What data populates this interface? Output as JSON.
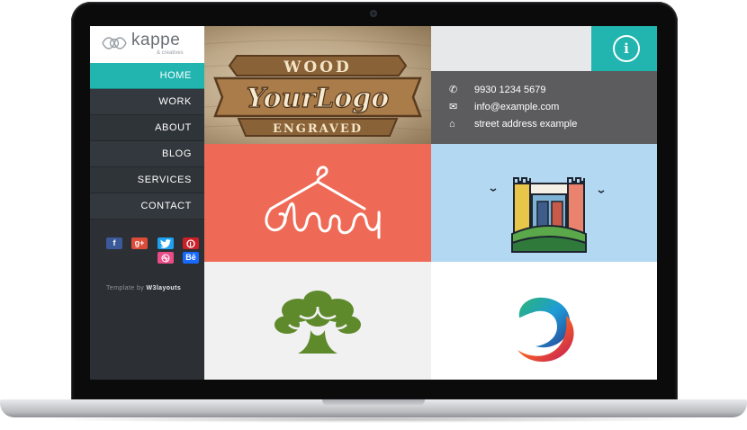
{
  "brand": {
    "name": "kappe",
    "tagline": "& creatives"
  },
  "nav": {
    "items": [
      {
        "label": "HOME"
      },
      {
        "label": "WORK"
      },
      {
        "label": "ABOUT"
      },
      {
        "label": "BLOG"
      },
      {
        "label": "SERVICES"
      },
      {
        "label": "CONTACT"
      }
    ],
    "active": "HOME"
  },
  "social": {
    "icons": [
      "facebook-icon",
      "google-plus-icon",
      "twitter-icon",
      "pinterest-icon",
      "dribbble-icon",
      "behance-icon"
    ],
    "labels": {
      "facebook": "f",
      "google_plus": "g+",
      "behance": "Bē"
    }
  },
  "credit": {
    "prefix": "Template by",
    "author": "W3layouts"
  },
  "contact": {
    "phone": "9930 1234 5679",
    "email": "info@example.com",
    "address": "street address example"
  },
  "tiles": {
    "wood_logo": {
      "top": "WOOD",
      "main": "YourLogo",
      "bottom": "ENGRAVED"
    },
    "closet": {
      "text": "closet"
    }
  },
  "colors": {
    "accent": "#22b5b0",
    "sidebar": "#2c3035",
    "closet_bg": "#ee6a56",
    "castle_bg": "#b3d8f1",
    "contact_panel": "#5c5c5e"
  }
}
